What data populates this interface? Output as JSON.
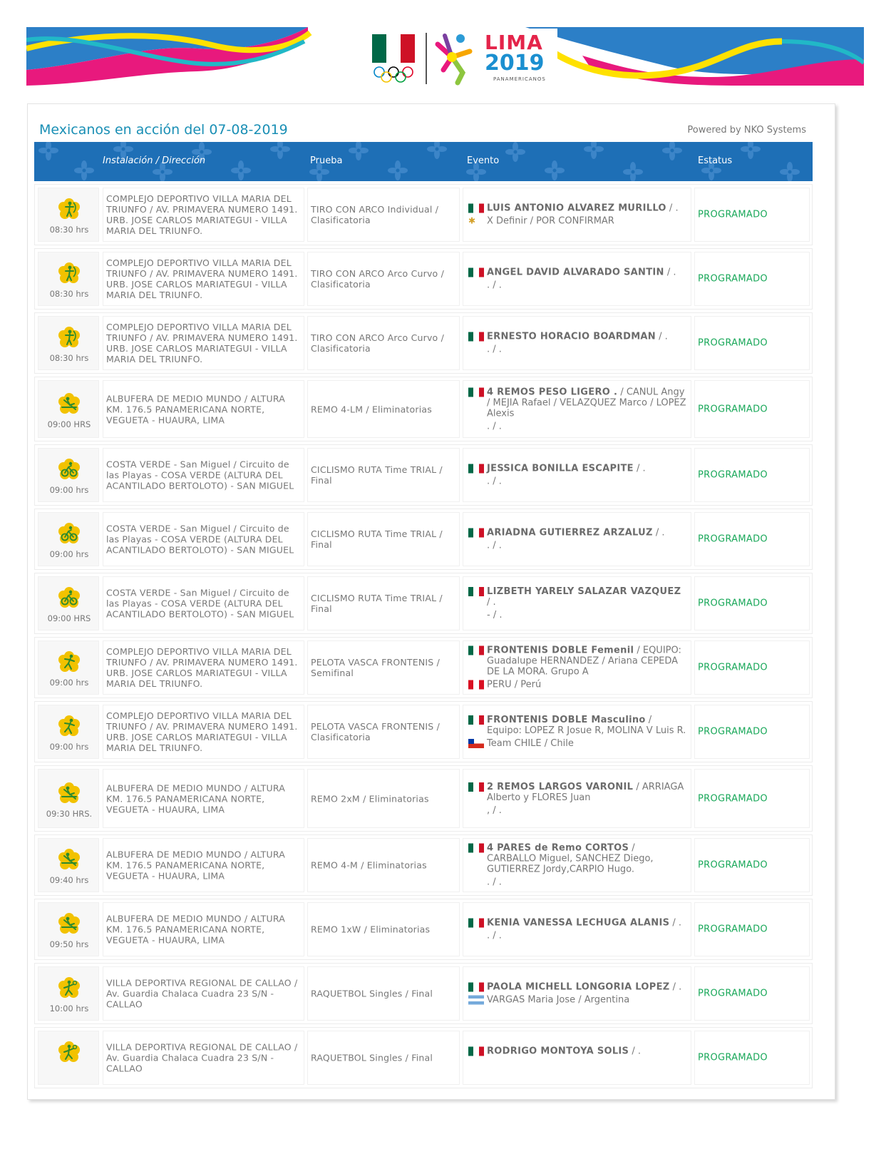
{
  "banner": {
    "logo_word": "LIMA",
    "logo_year": "2019",
    "logo_sub": "PANAMERICANOS"
  },
  "page": {
    "title": "Mexicanos en acción del 07-08-2019",
    "powered_by": "Powered by NKO Systems"
  },
  "table": {
    "headers": {
      "installation": "Instalación / Dirección",
      "test": "Prueba",
      "event": "Evento",
      "status": "Estatus"
    },
    "rows": [
      {
        "icon": "archery-icon",
        "time": "08:30 hrs",
        "installation": "COMPLEJO DEPORTIVO VILLA MARIA DEL TRIUNFO / AV. PRIMAVERA NUMERO 1491. URB. JOSE CARLOS MARIATEGUI - VILLA MARIA DEL TRIUNFO.",
        "test": "TIRO CON ARCO Individual / Clasificatoria",
        "athlete": "LUIS ANTONIO ALVAREZ MURILLO",
        "athlete_rest": " / .",
        "opponent_flag": "tbd",
        "opponent": "X Definir / POR CONFIRMAR",
        "status": "PROGRAMADO"
      },
      {
        "icon": "archery-icon",
        "time": "08:30 hrs",
        "installation": "COMPLEJO DEPORTIVO VILLA MARIA DEL TRIUNFO / AV. PRIMAVERA NUMERO 1491. URB. JOSE CARLOS MARIATEGUI - VILLA MARIA DEL TRIUNFO.",
        "test": "TIRO CON ARCO Arco Curvo / Clasificatoria",
        "athlete": "ANGEL DAVID ALVARADO SANTIN",
        "athlete_rest": " / .",
        "opponent_flag": "",
        "opponent": ". / .",
        "status": "PROGRAMADO"
      },
      {
        "icon": "archery-icon",
        "time": "08:30 hrs",
        "installation": "COMPLEJO DEPORTIVO VILLA MARIA DEL TRIUNFO / AV. PRIMAVERA NUMERO 1491. URB. JOSE CARLOS MARIATEGUI - VILLA MARIA DEL TRIUNFO.",
        "test": "TIRO CON ARCO Arco Curvo / Clasificatoria",
        "athlete": "ERNESTO HORACIO BOARDMAN",
        "athlete_rest": " / .",
        "opponent_flag": "",
        "opponent": ". / .",
        "status": "PROGRAMADO"
      },
      {
        "icon": "rowing-icon",
        "time": "09:00 HRS",
        "installation": "ALBUFERA DE MEDIO MUNDO / ALTURA KM. 176.5 PANAMERICANA NORTE, VEGUETA - HUAURA, LIMA",
        "test": "REMO 4-LM / Eliminatorias",
        "athlete": "4 REMOS PESO LIGERO .",
        "athlete_rest": " / CANUL Angy / MEJIA Rafael / VELAZQUEZ Marco / LOPEZ Alexis",
        "opponent_flag": "",
        "opponent": ". / .",
        "status": "PROGRAMADO"
      },
      {
        "icon": "cycling-icon",
        "time": "09:00 hrs",
        "installation": "COSTA VERDE - San Miguel / Circuito de las Playas - COSA VERDE (ALTURA DEL ACANTILADO BERTOLOTO) - SAN MIGUEL",
        "test": "CICLISMO RUTA Time TRIAL / Final",
        "athlete": "JESSICA BONILLA ESCAPITE",
        "athlete_rest": " / .",
        "opponent_flag": "",
        "opponent": ". / .",
        "status": "PROGRAMADO"
      },
      {
        "icon": "cycling-icon",
        "time": "09:00 hrs",
        "installation": "COSTA VERDE - San Miguel / Circuito de las Playas - COSA VERDE (ALTURA DEL ACANTILADO BERTOLOTO) - SAN MIGUEL",
        "test": "CICLISMO RUTA Time TRIAL / Final",
        "athlete": "ARIADNA GUTIERREZ ARZALUZ",
        "athlete_rest": " / .",
        "opponent_flag": "",
        "opponent": ". / .",
        "status": "PROGRAMADO"
      },
      {
        "icon": "cycling-icon",
        "time": "09:00 HRS",
        "installation": "COSTA VERDE - San Miguel / Circuito de las Playas - COSA VERDE (ALTURA DEL ACANTILADO BERTOLOTO) - SAN MIGUEL",
        "test": "CICLISMO RUTA Time TRIAL / Final",
        "athlete": "LIZBETH YARELY SALAZAR VAZQUEZ",
        "athlete_rest": " / .",
        "opponent_flag": "",
        "opponent": "- / .",
        "status": "PROGRAMADO"
      },
      {
        "icon": "pelota-icon",
        "time": "09:00 hrs",
        "installation": "COMPLEJO DEPORTIVO VILLA MARIA DEL TRIUNFO / AV. PRIMAVERA NUMERO 1491. URB. JOSE CARLOS MARIATEGUI - VILLA MARIA DEL TRIUNFO.",
        "test": "PELOTA VASCA FRONTENIS / Semifinal",
        "athlete": "FRONTENIS DOBLE Femenil",
        "athlete_rest": " / EQUIPO: Guadalupe HERNANDEZ / Ariana CEPEDA DE LA MORA. Grupo A",
        "opponent_flag": "pe",
        "opponent": "PERU / Perú",
        "status": "PROGRAMADO"
      },
      {
        "icon": "pelota-icon",
        "time": "09:00 hrs",
        "installation": "COMPLEJO DEPORTIVO VILLA MARIA DEL TRIUNFO / AV. PRIMAVERA NUMERO 1491. URB. JOSE CARLOS MARIATEGUI - VILLA MARIA DEL TRIUNFO.",
        "test": "PELOTA VASCA FRONTENIS / Clasificatoria",
        "athlete": "FRONTENIS DOBLE Masculino",
        "athlete_rest": " / Equipo: LOPEZ R Josue R, MOLINA V Luis R.",
        "opponent_flag": "cl",
        "opponent": "Team CHILE / Chile",
        "status": "PROGRAMADO"
      },
      {
        "icon": "rowing-icon",
        "time": "09:30 HRS.",
        "installation": "ALBUFERA DE MEDIO MUNDO / ALTURA KM. 176.5 PANAMERICANA NORTE, VEGUETA - HUAURA, LIMA",
        "test": "REMO 2xM / Eliminatorias",
        "athlete": "2 REMOS LARGOS VARONIL",
        "athlete_rest": " / ARRIAGA Alberto y FLORES Juan",
        "opponent_flag": "",
        "opponent": ", / .",
        "status": "PROGRAMADO"
      },
      {
        "icon": "rowing-icon",
        "time": "09:40 hrs",
        "installation": "ALBUFERA DE MEDIO MUNDO / ALTURA KM. 176.5 PANAMERICANA NORTE, VEGUETA - HUAURA, LIMA",
        "test": "REMO 4-M / Eliminatorias",
        "athlete": "4 PARES de Remo CORTOS",
        "athlete_rest": " / CARBALLO Miguel, SANCHEZ Diego, GUTIERREZ Jordy,CARPIO Hugo.",
        "opponent_flag": "",
        "opponent": ". / .",
        "status": "PROGRAMADO"
      },
      {
        "icon": "rowing-icon",
        "time": "09:50 hrs",
        "installation": "ALBUFERA DE MEDIO MUNDO / ALTURA KM. 176.5 PANAMERICANA NORTE, VEGUETA - HUAURA, LIMA",
        "test": "REMO 1xW / Eliminatorias",
        "athlete": "KENIA VANESSA LECHUGA ALANIS",
        "athlete_rest": " / .",
        "opponent_flag": "",
        "opponent": ". / .",
        "status": "PROGRAMADO"
      },
      {
        "icon": "racquetball-icon",
        "time": "10:00 hrs",
        "installation": "VILLA DEPORTIVA REGIONAL DE CALLAO / Av. Guardia Chalaca Cuadra 23 S/N - CALLAO",
        "test": "RAQUETBOL Singles / Final",
        "athlete": "PAOLA MICHELL LONGORIA LOPEZ",
        "athlete_rest": " / .",
        "opponent_flag": "ar",
        "opponent": "VARGAS Maria Jose / Argentina",
        "status": "PROGRAMADO"
      },
      {
        "icon": "racquetball-icon",
        "time": "",
        "installation": "VILLA DEPORTIVA REGIONAL DE CALLAO / Av. Guardia Chalaca Cuadra 23 S/N - CALLAO",
        "test": "RAQUETBOL Singles / Final",
        "athlete": "RODRIGO MONTOYA SOLIS",
        "athlete_rest": " / .",
        "opponent_flag": "",
        "opponent": "",
        "status": "PROGRAMADO"
      }
    ]
  },
  "colors": {
    "title": "#1a8fb5",
    "header": "#1e6fb6",
    "status": "#1aa85a",
    "icon_bg": "#f2c200",
    "icon_fg": "#2d8a2d"
  }
}
